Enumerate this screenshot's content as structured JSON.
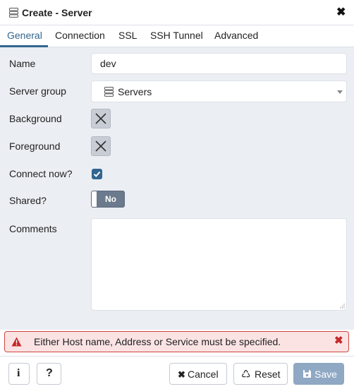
{
  "dialog": {
    "title": "Create - Server",
    "close_glyph": "✖"
  },
  "tabs": [
    {
      "label": "General"
    },
    {
      "label": "Connection"
    },
    {
      "label": "SSL"
    },
    {
      "label": "SSH Tunnel"
    },
    {
      "label": "Advanced"
    }
  ],
  "form": {
    "name_label": "Name",
    "name_value": "dev",
    "server_group_label": "Server group",
    "server_group_value": "Servers",
    "background_label": "Background",
    "foreground_label": "Foreground",
    "connect_now_label": "Connect now?",
    "connect_now_checked": true,
    "shared_label": "Shared?",
    "shared_value": "No",
    "comments_label": "Comments",
    "comments_value": ""
  },
  "error": {
    "message": "Either Host name, Address or Service must be specified.",
    "close_glyph": "✖"
  },
  "footer": {
    "info_label": "i",
    "help_label": "?",
    "cancel_glyph": "✖",
    "cancel_label": "Cancel",
    "reset_glyph": "♺",
    "reset_label": "Reset",
    "save_label": "Save"
  },
  "colors": {
    "accent": "#326690",
    "error_border": "#d0453f",
    "error_bg": "#fbe3e4",
    "save_bg": "#8fa8c3",
    "panel_bg": "#ebeef3"
  },
  "icons": {
    "title": "server-group-icon",
    "select": "server-group-icon",
    "color_pickers": "x-icon",
    "warning": "warning-triangle-icon",
    "save": "floppy-disk-icon"
  }
}
